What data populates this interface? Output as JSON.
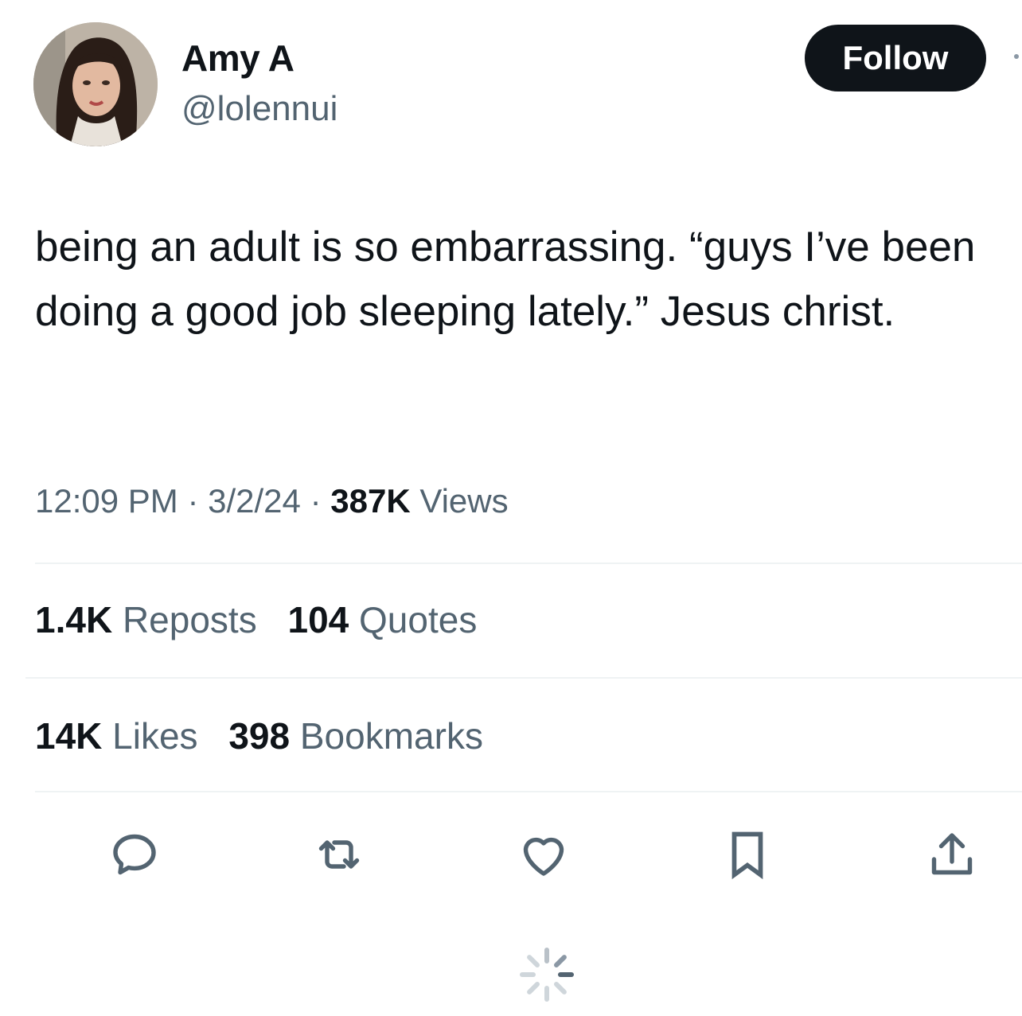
{
  "author": {
    "display_name": "Amy A",
    "handle": "@lolennui"
  },
  "follow_label": "Follow",
  "tweet": {
    "text": "being an adult is so embarrassing. “guys I’ve been doing a good job sleeping lately.” Jesus christ."
  },
  "meta": {
    "time": "12:09 PM",
    "separator": "·",
    "date": "3/2/24",
    "views_count": "387K",
    "views_label": "Views"
  },
  "stats": {
    "reposts_count": "1.4K",
    "reposts_label": "Reposts",
    "quotes_count": "104",
    "quotes_label": "Quotes",
    "likes_count": "14K",
    "likes_label": "Likes",
    "bookmarks_count": "398",
    "bookmarks_label": "Bookmarks"
  },
  "actions": {
    "icons": [
      "reply-icon",
      "repost-icon",
      "like-icon",
      "bookmark-icon",
      "share-icon"
    ]
  },
  "colors": {
    "text_primary": "#0f1419",
    "text_secondary": "#536471",
    "divider": "#eff3f4",
    "icon": "#536471"
  }
}
